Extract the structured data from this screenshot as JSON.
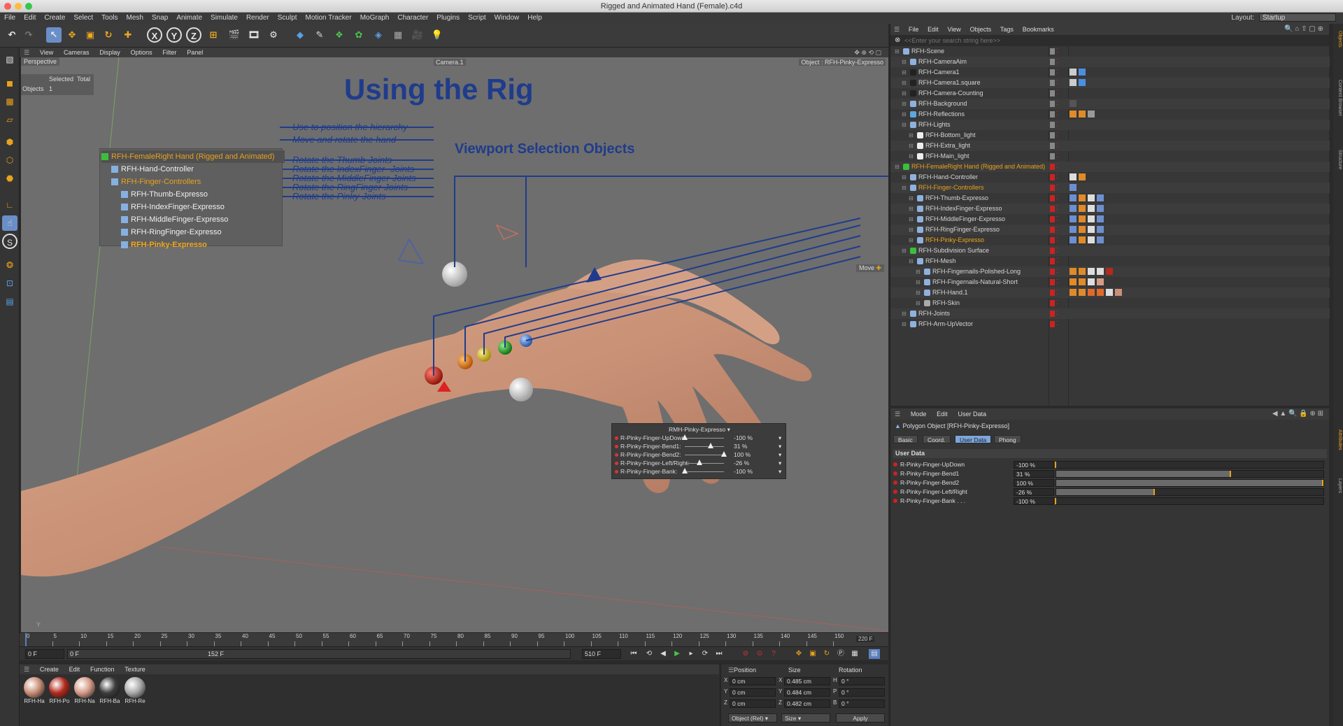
{
  "window": {
    "title": "Rigged and Animated Hand (Female).c4d"
  },
  "menubar": {
    "items": [
      "File",
      "Edit",
      "Create",
      "Select",
      "Tools",
      "Mesh",
      "Snap",
      "Animate",
      "Simulate",
      "Render",
      "Sculpt",
      "Motion Tracker",
      "MoGraph",
      "Character",
      "Plugins",
      "Script",
      "Window",
      "Help"
    ],
    "layout_label": "Layout:",
    "layout_value": "Startup"
  },
  "toolbar": {
    "x_label": "X",
    "y_label": "Y",
    "z_label": "Z"
  },
  "viewport": {
    "menu": [
      "View",
      "Cameras",
      "Display",
      "Options",
      "Filter",
      "Panel"
    ],
    "projection": "Perspective",
    "camera": "Camera.1",
    "object_label": "Object : RFH-Pinky-Expresso",
    "stats": {
      "selected_label": "Selected",
      "total_label": "Total",
      "objects_label": "Objects",
      "objects_selected": "1"
    },
    "title": "Using the Rig",
    "subtitle": "Viewport Selection Objects",
    "move_label": "Move",
    "axis_label": "Y",
    "hierarchy": [
      "RFH-FemaleRight Hand (Rigged and Animated)",
      "RFH-Hand-Controller",
      "RFH-Finger-Controllers",
      "RFH-Thumb-Expresso",
      "RFH-IndexFinger-Expresso",
      "RFH-MiddleFinger-Expresso",
      "RFH-RingFinger-Expresso",
      "RFH-Pinky-Expresso"
    ],
    "annotations": [
      "Use to position the hierarchy",
      "Move and rotate the hand",
      "Rotate the Thumb-Joints",
      "Rotate the IndexFinger -Joints",
      "Rotate the MiddleFinger-Joints",
      "Rotate the RingFinger-Joints",
      "Rotate the Pinky-Joints"
    ],
    "hud": {
      "title": "RMH-Pinky-Expresso",
      "rows": [
        {
          "label": "R-Pinky-Finger-UpDown:",
          "value": "-100 %",
          "pos": 0.0
        },
        {
          "label": "R-Pinky-Finger-Bend1:",
          "value": "31 %",
          "pos": 0.66
        },
        {
          "label": "R-Pinky-Finger-Bend2:",
          "value": "100 %",
          "pos": 1.0
        },
        {
          "label": "R-Pinky-Finger-Left/Right:",
          "value": "-26 %",
          "pos": 0.37
        },
        {
          "label": "R-Pinky-Finger-Bank:",
          "value": "-100 %",
          "pos": 0.0
        }
      ]
    }
  },
  "timeline": {
    "ticks": [
      "0",
      "5",
      "10",
      "15",
      "20",
      "25",
      "30",
      "35",
      "40",
      "45",
      "50",
      "55",
      "60",
      "65",
      "70",
      "75",
      "80",
      "85",
      "90",
      "95",
      "100",
      "105",
      "110",
      "115",
      "120",
      "125",
      "130",
      "135",
      "140",
      "145",
      "150"
    ],
    "end_frame": "220 F",
    "current": "0 F",
    "start_field": "0 F",
    "range_end": "152 F",
    "max_field": "510 F"
  },
  "materials": {
    "menu": [
      "Create",
      "Edit",
      "Function",
      "Texture"
    ],
    "items": [
      {
        "label": "RFH-Ha",
        "color": "#c98f78"
      },
      {
        "label": "RFH-Po",
        "color": "#b22a1e"
      },
      {
        "label": "RFH-Na",
        "color": "#d59b88"
      },
      {
        "label": "RFH-Ba",
        "color": "#3d3d3d"
      },
      {
        "label": "RFH-Re",
        "color": "#aaaaaa"
      }
    ]
  },
  "coords": {
    "headers": [
      "Position",
      "Size",
      "Rotation"
    ],
    "rows": [
      {
        "axis": "X",
        "pos": "0 cm",
        "saxis": "X",
        "size": "0.485 cm",
        "raxis": "H",
        "rot": "0 °"
      },
      {
        "axis": "Y",
        "pos": "0 cm",
        "saxis": "Y",
        "size": "0.484 cm",
        "raxis": "P",
        "rot": "0 °"
      },
      {
        "axis": "Z",
        "pos": "0 cm",
        "saxis": "Z",
        "size": "0.482 cm",
        "raxis": "B",
        "rot": "0 °"
      }
    ],
    "mode_select": "Object (Rel)",
    "size_select": "Size",
    "apply_label": "Apply"
  },
  "objects": {
    "menu": [
      "File",
      "Edit",
      "View",
      "Objects",
      "Tags",
      "Bookmarks"
    ],
    "search_placeholder": "<<Enter your search string here>>",
    "rows": [
      {
        "name": "RFH-Scene",
        "indent": 0,
        "color": "#d6d6d6",
        "icon": "#8fb1de",
        "f1": "#888",
        "tags": []
      },
      {
        "name": "RFH-CameraAim",
        "indent": 1,
        "color": "#d6d6d6",
        "icon": "#8fb1de",
        "f1": "#888",
        "tags": []
      },
      {
        "name": "RFH-Camera1",
        "indent": 1,
        "color": "#d6d6d6",
        "icon": "#222",
        "f1": "#888",
        "tags": [
          "#ccc",
          "#4a8fe0"
        ]
      },
      {
        "name": "RFH-Camera1.square",
        "indent": 1,
        "color": "#d6d6d6",
        "icon": "#222",
        "f1": "#888",
        "tags": [
          "#ccc",
          "#4a8fe0"
        ]
      },
      {
        "name": "RFH-Camera-Counting",
        "indent": 1,
        "color": "#d6d6d6",
        "icon": "#222",
        "f1": "#888",
        "tags": []
      },
      {
        "name": "RFH-Background",
        "indent": 1,
        "color": "#d6d6d6",
        "icon": "#8fb1de",
        "f1": "#888",
        "tags": [
          "#555"
        ]
      },
      {
        "name": "RFH-Reflections",
        "indent": 1,
        "color": "#d6d6d6",
        "icon": "#59a8e0",
        "f1": "#888",
        "tags": [
          "#e08a2a",
          "#e08a2a",
          "#999"
        ]
      },
      {
        "name": "RFH-Lights",
        "indent": 1,
        "color": "#d6d6d6",
        "icon": "#8fb1de",
        "f1": "#888",
        "tags": []
      },
      {
        "name": "RFH-Bottom_light",
        "indent": 2,
        "color": "#d6d6d6",
        "icon": "#eee",
        "f1": "#888",
        "tags": []
      },
      {
        "name": "RFH-Extra_light",
        "indent": 2,
        "color": "#d6d6d6",
        "icon": "#eee",
        "f1": "#888",
        "tags": []
      },
      {
        "name": "RFH-Main_light",
        "indent": 2,
        "color": "#d6d6d6",
        "icon": "#eee",
        "f1": "#888",
        "tags": []
      },
      {
        "name": "RFH-FemaleRight Hand (Rigged and Animated)",
        "indent": 0,
        "color": "#e8a21c",
        "icon": "#3bbf3b",
        "f1": "#c22",
        "tags": []
      },
      {
        "name": "RFH-Hand-Controller",
        "indent": 1,
        "color": "#d6d6d6",
        "icon": "#8fb1de",
        "f1": "#c22",
        "tags": [
          "#ddd",
          "#e08a2a"
        ]
      },
      {
        "name": "RFH-Finger-Controllers",
        "indent": 1,
        "color": "#e8a21c",
        "icon": "#8fb1de",
        "f1": "#c22",
        "tags": [
          "#6c8fd0"
        ]
      },
      {
        "name": "RFH-Thumb-Expresso",
        "indent": 2,
        "color": "#d6d6d6",
        "icon": "#8fb1de",
        "f1": "#c22",
        "tags": [
          "#6c8fd0",
          "#e08a2a",
          "#ddd",
          "#6c8fd0"
        ]
      },
      {
        "name": "RFH-IndexFinger-Expresso",
        "indent": 2,
        "color": "#d6d6d6",
        "icon": "#8fb1de",
        "f1": "#c22",
        "tags": [
          "#6c8fd0",
          "#e08a2a",
          "#ddd",
          "#6c8fd0"
        ]
      },
      {
        "name": "RFH-MiddleFinger-Expresso",
        "indent": 2,
        "color": "#d6d6d6",
        "icon": "#8fb1de",
        "f1": "#c22",
        "tags": [
          "#6c8fd0",
          "#e08a2a",
          "#ddd",
          "#6c8fd0"
        ]
      },
      {
        "name": "RFH-RingFinger-Expresso",
        "indent": 2,
        "color": "#d6d6d6",
        "icon": "#8fb1de",
        "f1": "#c22",
        "tags": [
          "#6c8fd0",
          "#e08a2a",
          "#ddd",
          "#6c8fd0"
        ]
      },
      {
        "name": "RFH-Pinky-Expresso",
        "indent": 2,
        "color": "#f0a81c",
        "icon": "#8fb1de",
        "f1": "#c22",
        "tags": [
          "#6c8fd0",
          "#e08a2a",
          "#ddd",
          "#6c8fd0"
        ]
      },
      {
        "name": "RFH-Subdivision Surface",
        "indent": 1,
        "color": "#d6d6d6",
        "icon": "#3bbf3b",
        "f1": "#c22",
        "tags": []
      },
      {
        "name": "RFH-Mesh",
        "indent": 2,
        "color": "#d6d6d6",
        "icon": "#8fb1de",
        "f1": "#c22",
        "tags": []
      },
      {
        "name": "RFH-Fingernails-Polished-Long",
        "indent": 3,
        "color": "#d6d6d6",
        "icon": "#8fb1de",
        "f1": "#c22",
        "tags": [
          "#e08a2a",
          "#e08a2a",
          "#ddd",
          "#ddd",
          "#b22a1e"
        ]
      },
      {
        "name": "RFH-Fingernails-Natural-Short",
        "indent": 3,
        "color": "#d6d6d6",
        "icon": "#8fb1de",
        "f1": "#c22",
        "tags": [
          "#e08a2a",
          "#e08a2a",
          "#ddd",
          "#d59b88"
        ]
      },
      {
        "name": "RFH-Hand.1",
        "indent": 3,
        "color": "#d6d6d6",
        "icon": "#8fb1de",
        "f1": "#c22",
        "tags": [
          "#e08a2a",
          "#e08a2a",
          "#e06a2a",
          "#e06a2a",
          "#ddd",
          "#c98f78"
        ]
      },
      {
        "name": "RFH-Skin",
        "indent": 3,
        "color": "#d6d6d6",
        "icon": "#aaa",
        "f1": "#c22",
        "tags": []
      },
      {
        "name": "RFH-Joints",
        "indent": 1,
        "color": "#d6d6d6",
        "icon": "#8fb1de",
        "f1": "#c22",
        "tags": []
      },
      {
        "name": "RFH-Arm-UpVector",
        "indent": 1,
        "color": "#d6d6d6",
        "icon": "#8fb1de",
        "f1": "#c22",
        "tags": []
      }
    ]
  },
  "attributes": {
    "menu": [
      "Mode",
      "Edit",
      "User Data"
    ],
    "object_title": "Polygon Object [RFH-Pinky-Expresso]",
    "tabs": [
      "Basic",
      "Coord.",
      "User Data",
      "Phong"
    ],
    "active_tab": "User Data",
    "section": "User Data",
    "params": [
      {
        "name": "R-Pinky-Finger-UpDown",
        "value": "-100 %",
        "fill": 0.0
      },
      {
        "name": "R-Pinky-Finger-Bend1",
        "value": "31 %",
        "fill": 0.655
      },
      {
        "name": "R-Pinky-Finger-Bend2",
        "value": "100 %",
        "fill": 1.0
      },
      {
        "name": "R-Pinky-Finger-Left/Right",
        "value": "-26 %",
        "fill": 0.37
      },
      {
        "name": "R-Pinky-Finger-Bank . . .",
        "value": "-100 %",
        "fill": 0.0
      }
    ]
  },
  "side_tabs": [
    "Objects",
    "Content Browser",
    "Structure",
    "Attributes",
    "Layers"
  ]
}
